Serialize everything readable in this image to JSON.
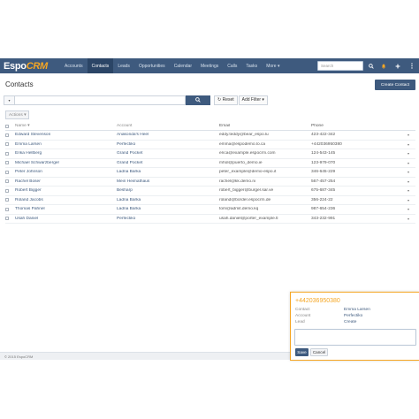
{
  "app": {
    "logo_main": "Espo",
    "logo_accent": "CRM"
  },
  "nav": {
    "tabs": [
      {
        "label": "Accounts",
        "active": false
      },
      {
        "label": "Contacts",
        "active": true
      },
      {
        "label": "Leads",
        "active": false
      },
      {
        "label": "Opportunities",
        "active": false
      },
      {
        "label": "Calendar",
        "active": false
      },
      {
        "label": "Meetings",
        "active": false
      },
      {
        "label": "Calls",
        "active": false
      },
      {
        "label": "Tasks",
        "active": false
      },
      {
        "label": "More ▾",
        "active": false
      }
    ],
    "search_placeholder": "Search",
    "icons": [
      "bell-icon",
      "plus-icon",
      "menu-icon"
    ]
  },
  "page": {
    "title": "Contacts",
    "create_label": "Create Contact"
  },
  "filter": {
    "dropdown_glyph": "▾",
    "search_icon": "search-icon",
    "reset_label": "↻ Reset",
    "add_filter_label": "Add Filter ▾"
  },
  "actions_label": "Actions ▾",
  "table": {
    "headers": {
      "name": "Name ▾",
      "account": "Account",
      "email": "Email",
      "phone": "Phone"
    },
    "rows": [
      {
        "name": "Edward Stevenson",
        "account": "Anakonda's Heel",
        "email": "eddy.teddy@bear_espo.lu",
        "phone": "423-422-342"
      },
      {
        "name": "Emma Larsen",
        "account": "Perfectiko",
        "email": "emma@espodemo.lo.ca",
        "phone": "+442036950380"
      },
      {
        "name": "Erika Hellberg",
        "account": "Grand Pocket",
        "email": "erica@example.espocrm.com",
        "phone": "124-543-145"
      },
      {
        "name": "Michael Schwarzberger",
        "account": "Grand Pocket",
        "email": "mhol@puerto_demo.ie",
        "phone": "123-979-070"
      },
      {
        "name": "Peter Johnson",
        "account": "Ladna Barka",
        "email": "peter_example@demo-espo.it",
        "phone": "346-645-229"
      },
      {
        "name": "Rachel Boser",
        "account": "Mein Heimathaus",
        "email": "rachel@kk.demo.ni",
        "phone": "567-457-254"
      },
      {
        "name": "Robert Bigger",
        "account": "Besharp",
        "email": "robert_bigger@burger.sar.ve",
        "phone": "675-687-345"
      },
      {
        "name": "Roland Jacobs",
        "account": "Ladna Barka",
        "email": "roland@border.espocrm.de",
        "phone": "356-224-22"
      },
      {
        "name": "Thomas Pahnel",
        "account": "Ladna Barka",
        "email": "tom@admit.demo.kq",
        "phone": "987-654-236"
      },
      {
        "name": "Usah Daniel",
        "account": "Perfectiko",
        "email": "usah.daniel@porter_example.tl",
        "phone": "343-232-991"
      }
    ]
  },
  "footer": {
    "text": "© 2015 EspoCRM"
  },
  "popup": {
    "phone": "+442036950380",
    "contact_label": "Contact",
    "contact_value": "Emma Larsen",
    "account_label": "Account",
    "account_value": "Perfectiko",
    "lead_label": "Lead",
    "lead_value": "Create",
    "save_label": "Save",
    "cancel_label": "Cancel"
  },
  "colors": {
    "navbar": "#3e5a7e",
    "navbar_active": "#2b4566",
    "accent": "#f5a623",
    "link": "#3e5a7e"
  }
}
